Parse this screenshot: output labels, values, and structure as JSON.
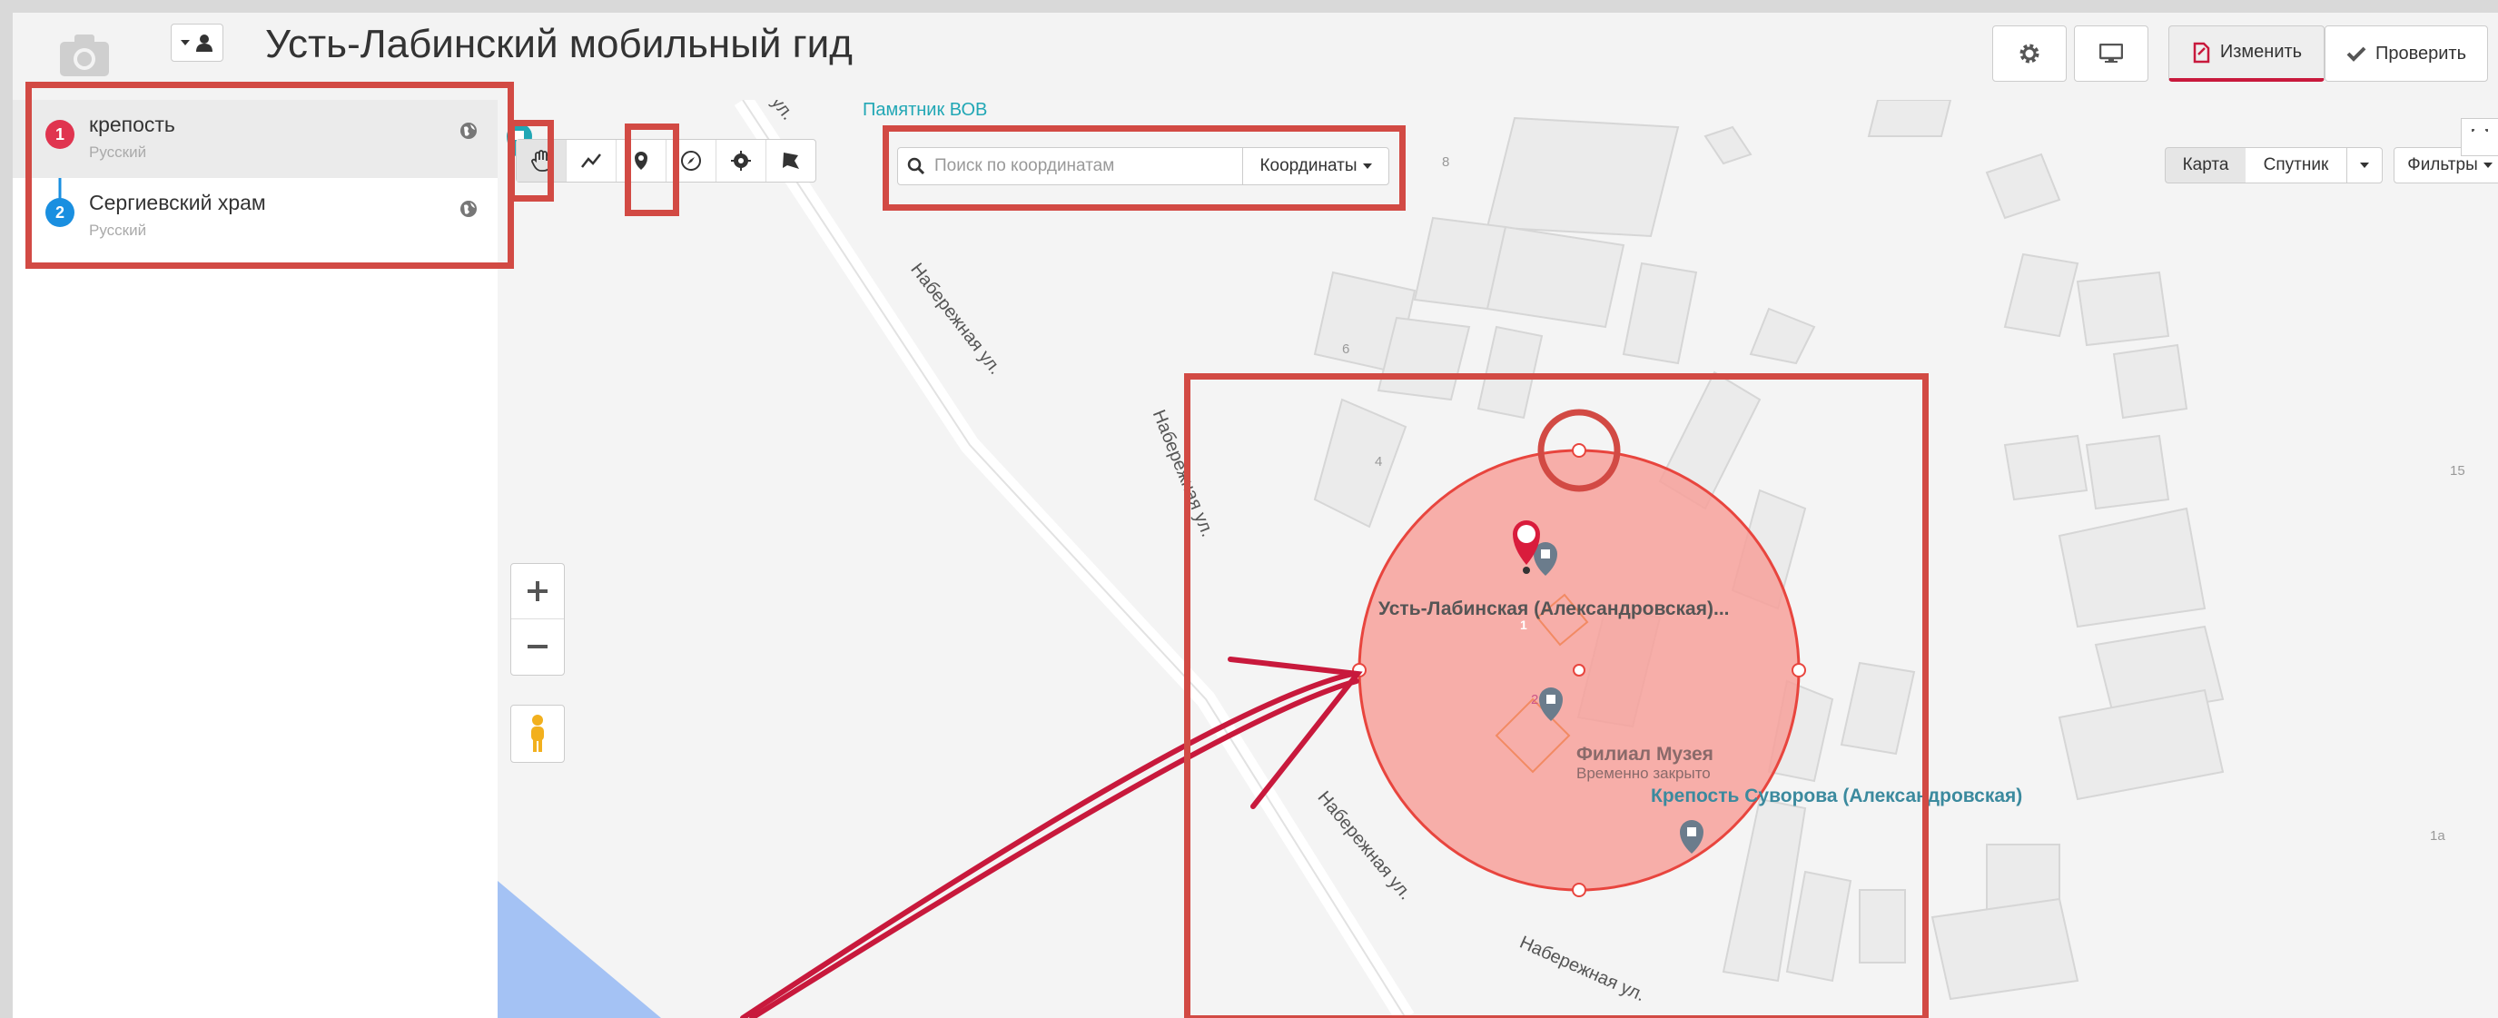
{
  "header": {
    "title": "Усть-Лабинский мобильный гид",
    "edit_label": "Изменить",
    "check_label": "Проверить"
  },
  "sidebar": {
    "items": [
      {
        "number": "1",
        "name": "крепость",
        "language": "Русский",
        "color": "#e0344f"
      },
      {
        "number": "2",
        "name": "Сергиевский храм",
        "language": "Русский",
        "color": "#1a8fe0"
      }
    ]
  },
  "search": {
    "placeholder": "Поиск по координатам",
    "dropdown_label": "Координаты"
  },
  "map_type": {
    "map_label": "Карта",
    "satellite_label": "Спутник",
    "filters_label": "Фильтры"
  },
  "map": {
    "street_labels": [
      "Набережная ул.",
      "Набережная ул.",
      "Набережная ул.",
      "Набережная ул.",
      "ул."
    ],
    "pois": [
      {
        "name": "Усть-Лабинская (Александровская)..."
      },
      {
        "name": "Филиал Музея",
        "status": "Временно закрыто"
      },
      {
        "name": "Крепость Суворова (Александровская)"
      },
      {
        "name": "Памятник ВОВ"
      }
    ],
    "house_numbers": [
      "8",
      "6",
      "4",
      "2",
      "15",
      "1а"
    ],
    "marker_number": "1"
  },
  "colors": {
    "accent": "#c8193c",
    "annotation": "#d24a44",
    "circle_fill": "#f7a19b",
    "water": "#a4c2f4"
  }
}
